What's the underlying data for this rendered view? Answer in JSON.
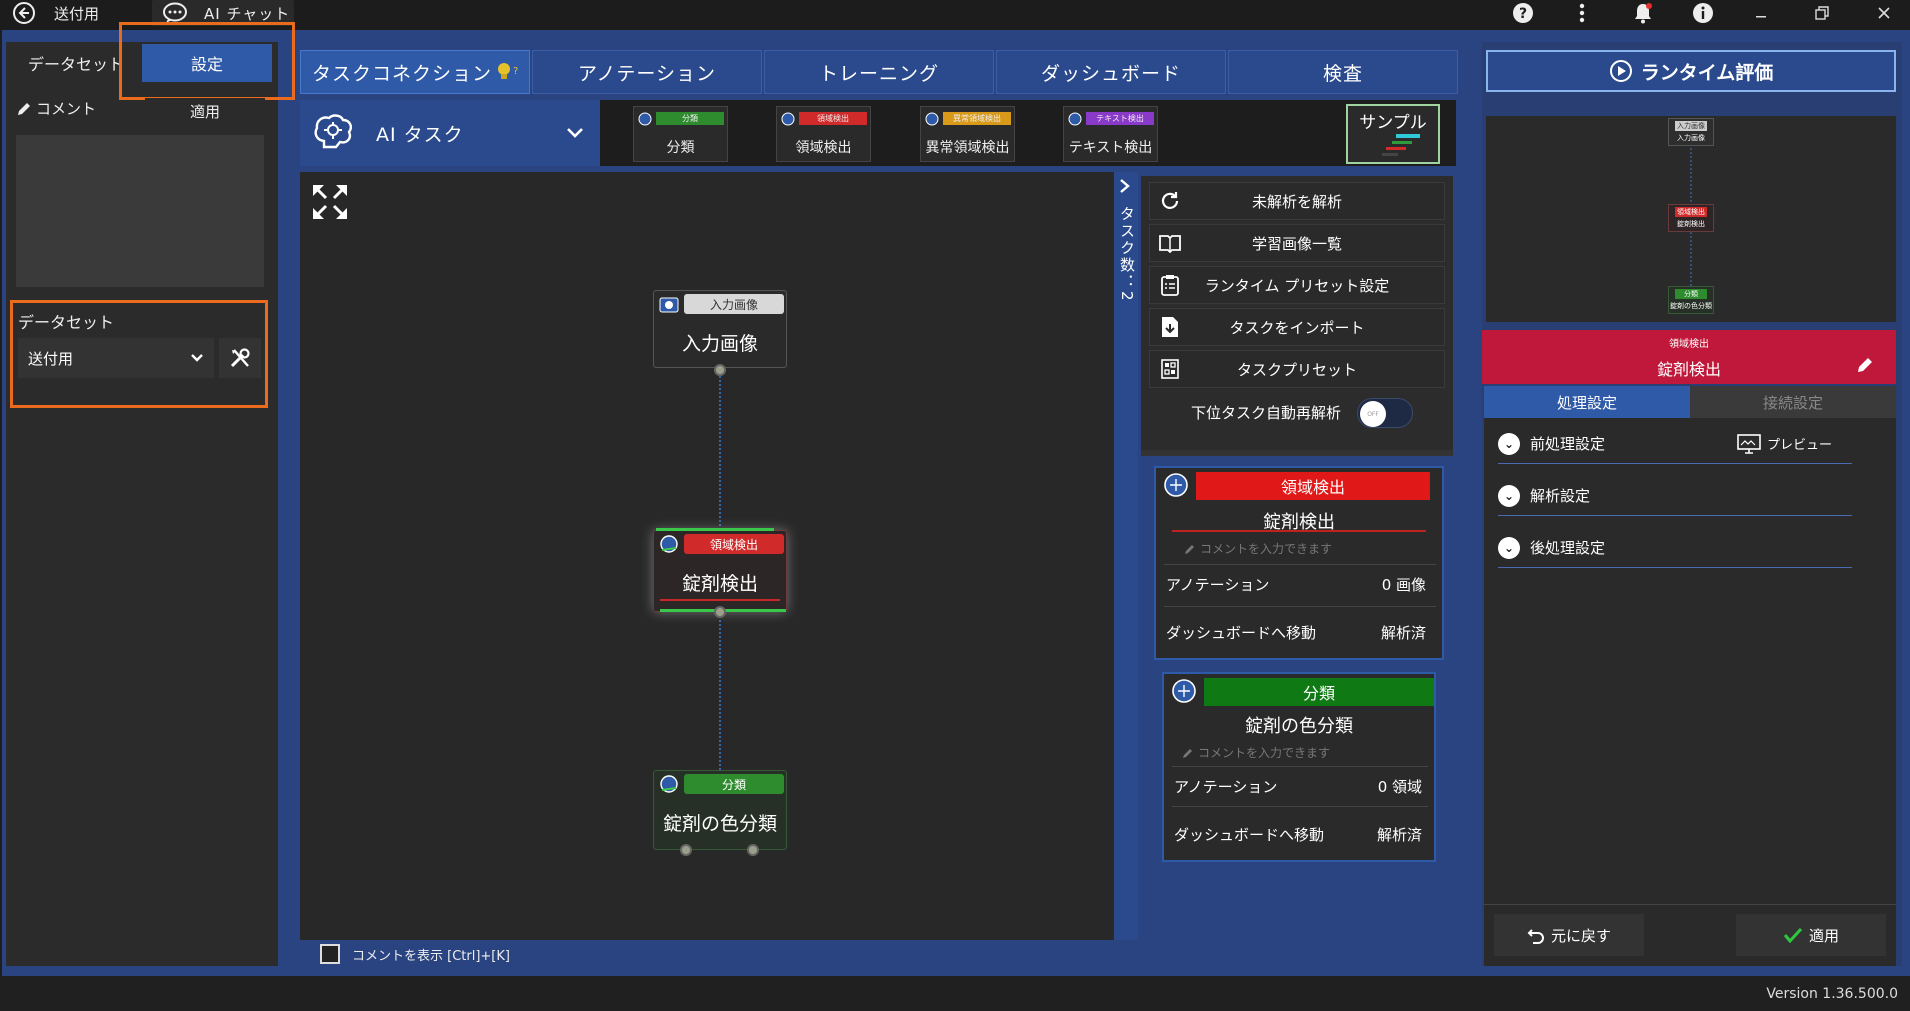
{
  "titlebar": {
    "back_label": "送付用",
    "ai_chat_label": "AI チャット"
  },
  "left": {
    "tab_dataset": "データセット",
    "tab_settings": "設定",
    "comment_label": "コメント",
    "apply_label": "適用",
    "dataset_label": "データセット",
    "dataset_value": "送付用"
  },
  "nav": {
    "tabs": [
      "タスクコネクション",
      "アノテーション",
      "トレーニング",
      "ダッシュボード",
      "検査"
    ]
  },
  "aitask": {
    "label": "AI タスク",
    "types": [
      {
        "tag": "分類",
        "label": "分類",
        "color": "#2e8b2e"
      },
      {
        "tag": "領域検出",
        "label": "領域検出",
        "color": "#d02a2a"
      },
      {
        "tag": "異常領域検出",
        "label": "異常領域検出",
        "color": "#d99a1a"
      },
      {
        "tag": "テキスト検出",
        "label": "テキスト検出",
        "color": "#8a3ac8"
      }
    ],
    "sample_label": "サンプル"
  },
  "canvas": {
    "nodes": [
      {
        "tag": "入力画像",
        "title": "入力画像"
      },
      {
        "tag": "領域検出",
        "title": "錠剤検出"
      },
      {
        "tag": "分類",
        "title": "錠剤の色分類"
      }
    ],
    "show_comment_label": "コメントを表示 [Ctrl]+[K]"
  },
  "sidetab": {
    "label": "タスク数：2"
  },
  "actions": {
    "items": [
      "未解析を解析",
      "学習画像一覧",
      "ランタイム プリセット設定",
      "タスクをインポート",
      "タスクプリセット"
    ],
    "auto_reanalyze": "下位タスク自動再解析",
    "toggle_text": "OFF"
  },
  "cards": [
    {
      "tag": "領域検出",
      "title": "錠剤検出",
      "comment_placeholder": "コメントを入力できます",
      "annotation_label": "アノテーション",
      "annotation_value": "0 画像",
      "dashboard_label": "ダッシュボードへ移動",
      "dashboard_value": "解析済",
      "color": "#e01818"
    },
    {
      "tag": "分類",
      "title": "錠剤の色分類",
      "comment_placeholder": "コメントを入力できます",
      "annotation_label": "アノテーション",
      "annotation_value": "0 領域",
      "dashboard_label": "ダッシュボードへ移動",
      "dashboard_value": "解析済",
      "color": "#0f7a14"
    }
  ],
  "right": {
    "runtime_label": "ランタイム評価",
    "mini_nodes": [
      "入力画像",
      "錠剤検出",
      "錠剤の色分類"
    ],
    "mini_tags": [
      "入力画像",
      "領域検出",
      "分類"
    ],
    "selected_tag": "領域検出",
    "selected_title": "錠剤検出",
    "tab_processing": "処理設定",
    "tab_connection": "接続設定",
    "settings": [
      "前処理設定",
      "解析設定",
      "後処理設定"
    ],
    "preview_label": "プレビュー",
    "revert_label": "元に戻す",
    "apply_label": "適用"
  },
  "status": {
    "version": "Version 1.36.500.0"
  }
}
